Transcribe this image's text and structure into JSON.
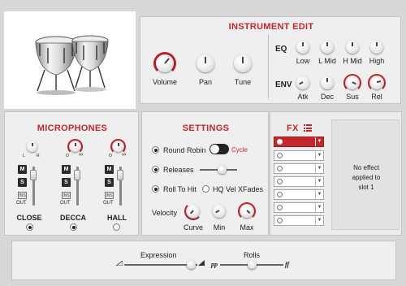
{
  "instrument_edit": {
    "title": "INSTRUMENT EDIT",
    "knobs": [
      {
        "label": "Volume"
      },
      {
        "label": "Pan"
      },
      {
        "label": "Tune"
      }
    ],
    "eq": {
      "label": "EQ",
      "knobs": [
        {
          "label": "Low"
        },
        {
          "label": "L Mid"
        },
        {
          "label": "H Mid"
        },
        {
          "label": "High"
        }
      ]
    },
    "env": {
      "label": "ENV",
      "knobs": [
        {
          "label": "Atk"
        },
        {
          "label": "Dec"
        },
        {
          "label": "Sus"
        },
        {
          "label": "Rel"
        }
      ]
    }
  },
  "microphones": {
    "title": "MICROPHONES",
    "pan_left_label": "L",
    "pan_right_label": "R",
    "phase_label": "O",
    "infinity_label": "∞",
    "mute_label": "M",
    "solo_label": "S",
    "ins_label": "INS",
    "out_label": "OUT",
    "mics": [
      {
        "name": "CLOSE",
        "selected": true
      },
      {
        "name": "DECCA",
        "selected": true
      },
      {
        "name": "HALL",
        "selected": false
      }
    ]
  },
  "settings": {
    "title": "SETTINGS",
    "round_robin_label": "Round Robin",
    "cycle_label": "Cycle",
    "releases_label": "Releases",
    "releases_level": 0.6,
    "roll_to_hit_label": "Roll To Hit",
    "hq_vel_label": "HQ Vel XFades",
    "velocity_label": "Velocity",
    "velocity_knobs": [
      {
        "label": "Curve"
      },
      {
        "label": "Min"
      },
      {
        "label": "Max"
      }
    ]
  },
  "fx": {
    "title": "FX",
    "slot_count": 8,
    "selected_slot": 1,
    "empty_message": "No effect applied to slot 1"
  },
  "performance": {
    "expression_label": "Expression",
    "expression_level": 0.92,
    "rolls_label": "Rolls",
    "rolls_left": "pp",
    "rolls_right": "ff",
    "rolls_level": 0.5
  },
  "colors": {
    "accent": "#c0282d",
    "panel": "#efefef",
    "background": "#d8d8d8"
  }
}
